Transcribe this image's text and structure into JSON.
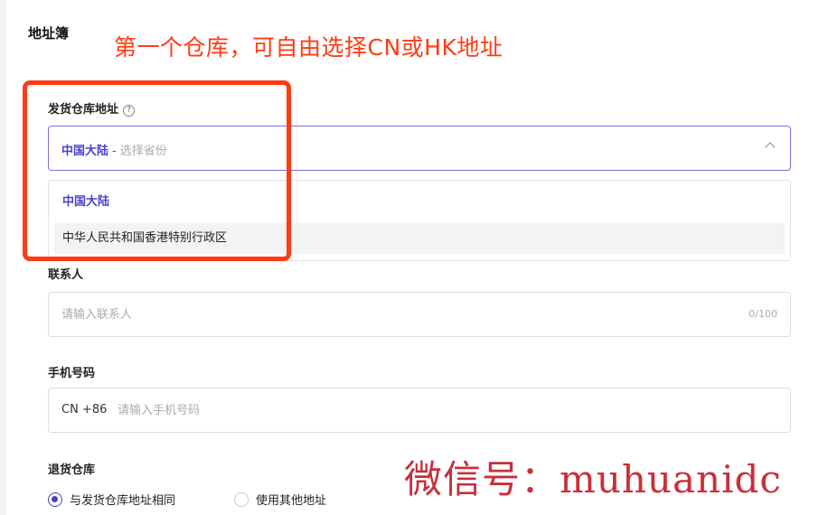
{
  "section": {
    "title": "地址簿"
  },
  "annotation": {
    "text": "第一个仓库，可自由选择CN或HK地址"
  },
  "warehouse": {
    "label": "发货仓库地址",
    "help_icon": "?",
    "selected_region": "中国大陆",
    "dash": "-",
    "province_placeholder": "选择省份",
    "options": [
      "中国大陆",
      "中华人民共和国香港特别行政区"
    ]
  },
  "contact": {
    "label": "联系人",
    "placeholder": "请输入联系人",
    "counter": "0/100"
  },
  "phone": {
    "label": "手机号码",
    "prefix": "CN +86",
    "placeholder": "请输入手机号码"
  },
  "return_warehouse": {
    "label": "退货仓库",
    "options": [
      "与发货仓库地址相同",
      "使用其他地址"
    ],
    "selected_index": 0
  },
  "watermark": {
    "text": "微信号：muhuanidc"
  },
  "colors": {
    "accent": "#4a3fcf",
    "annotation": "#ff3b14",
    "watermark": "#c9303a"
  }
}
